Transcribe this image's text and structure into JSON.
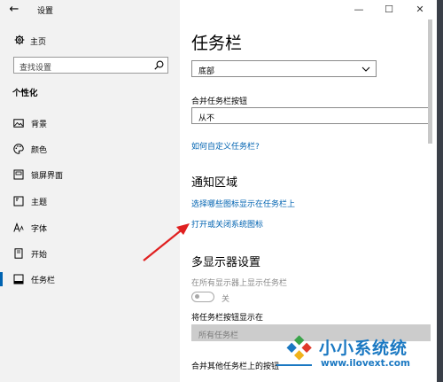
{
  "window": {
    "back_icon": "←",
    "title": "设置",
    "controls": {
      "minimize": "—",
      "maximize": "☐",
      "close": "✕"
    }
  },
  "sidebar": {
    "home_label": "主页",
    "search_placeholder": "查找设置",
    "section_title": "个性化",
    "items": [
      {
        "label": "背景",
        "icon": "image-icon",
        "active": false
      },
      {
        "label": "颜色",
        "icon": "palette-icon",
        "active": false
      },
      {
        "label": "锁屏界面",
        "icon": "lock-screen-icon",
        "active": false
      },
      {
        "label": "主题",
        "icon": "theme-icon",
        "active": false
      },
      {
        "label": "字体",
        "icon": "font-icon",
        "active": false
      },
      {
        "label": "开始",
        "icon": "start-icon",
        "active": false
      },
      {
        "label": "任务栏",
        "icon": "taskbar-icon",
        "active": true
      }
    ]
  },
  "main": {
    "page_title": "任务栏",
    "position_select_value": "底部",
    "combine_label": "合并任务栏按钮",
    "combine_select_value": "从不",
    "customize_link": "如何自定义任务栏?",
    "notify_title": "通知区域",
    "notify_link_1": "选择哪些图标显示在任务栏上",
    "notify_link_2": "打开或关闭系统图标",
    "multi_title": "多显示器设置",
    "multi_show_label": "在所有显示器上显示任务栏",
    "multi_toggle_label": "关",
    "multi_toggle_on": false,
    "show_buttons_label": "将任务栏按钮显示在",
    "show_buttons_value": "所有任务栏",
    "combine_other_label": "合并其他任务栏上的按钮"
  },
  "watermark": {
    "text": "小小系统统",
    "url": "www.ilovext.com"
  },
  "colors": {
    "accent": "#0063b1",
    "sidebar_bg": "#f2f2f2",
    "arrow": "#e02020",
    "watermark": "#1a78c2"
  }
}
